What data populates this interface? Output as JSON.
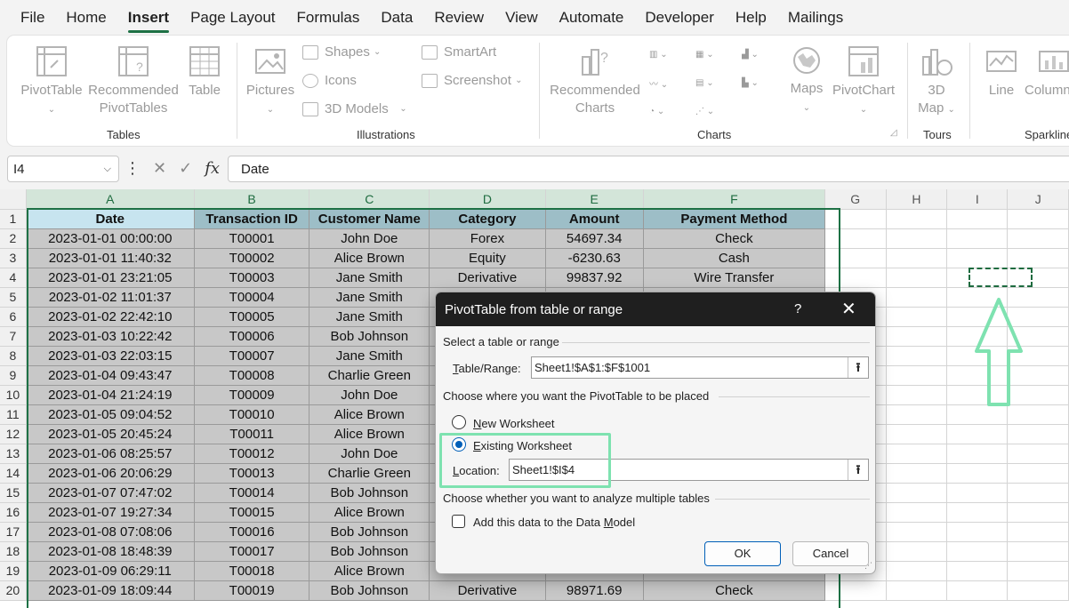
{
  "menu": [
    "File",
    "Home",
    "Insert",
    "Page Layout",
    "Formulas",
    "Data",
    "Review",
    "View",
    "Automate",
    "Developer",
    "Help",
    "Mailings"
  ],
  "active_menu_index": 2,
  "ribbon": {
    "tables": {
      "pivottable": "PivotTable",
      "recommended_pivottables_1": "Recommended",
      "recommended_pivottables_2": "PivotTables",
      "table": "Table",
      "label": "Tables"
    },
    "illustrations": {
      "pictures": "Pictures",
      "shapes": "Shapes",
      "icons": "Icons",
      "models_3d": "3D Models",
      "smartart": "SmartArt",
      "screenshot": "Screenshot",
      "label": "Illustrations"
    },
    "charts": {
      "recommended_1": "Recommended",
      "recommended_2": "Charts",
      "maps": "Maps",
      "pivotchart": "PivotChart",
      "label": "Charts"
    },
    "tours": {
      "map3d_1": "3D",
      "map3d_2": "Map",
      "label": "Tours"
    },
    "sparklines": {
      "line": "Line",
      "column": "Column",
      "label": "Sparklines"
    }
  },
  "formula_bar": {
    "name_box": "I4",
    "fx": "fx",
    "content": "Date"
  },
  "columns": [
    "A",
    "B",
    "C",
    "D",
    "E",
    "F",
    "G",
    "H",
    "I",
    "J"
  ],
  "headers": [
    "Date",
    "Transaction ID",
    "Customer Name",
    "Category",
    "Amount",
    "Payment Method"
  ],
  "rows": [
    [
      "2023-01-01 00:00:00",
      "T00001",
      "John Doe",
      "Forex",
      "54697.34",
      "Check"
    ],
    [
      "2023-01-01 11:40:32",
      "T00002",
      "Alice Brown",
      "Equity",
      "-6230.63",
      "Cash"
    ],
    [
      "2023-01-01 23:21:05",
      "T00003",
      "Jane Smith",
      "Derivative",
      "99837.92",
      "Wire Transfer"
    ],
    [
      "2023-01-02 11:01:37",
      "T00004",
      "Jane Smith",
      "",
      "",
      ""
    ],
    [
      "2023-01-02 22:42:10",
      "T00005",
      "Jane Smith",
      "",
      "",
      ""
    ],
    [
      "2023-01-03 10:22:42",
      "T00006",
      "Bob Johnson",
      "",
      "",
      ""
    ],
    [
      "2023-01-03 22:03:15",
      "T00007",
      "Jane Smith",
      "",
      "",
      ""
    ],
    [
      "2023-01-04 09:43:47",
      "T00008",
      "Charlie Green",
      "",
      "",
      ""
    ],
    [
      "2023-01-04 21:24:19",
      "T00009",
      "John Doe",
      "",
      "",
      ""
    ],
    [
      "2023-01-05 09:04:52",
      "T00010",
      "Alice Brown",
      "",
      "",
      ""
    ],
    [
      "2023-01-05 20:45:24",
      "T00011",
      "Alice Brown",
      "",
      "",
      ""
    ],
    [
      "2023-01-06 08:25:57",
      "T00012",
      "John Doe",
      "",
      "",
      ""
    ],
    [
      "2023-01-06 20:06:29",
      "T00013",
      "Charlie Green",
      "",
      "",
      ""
    ],
    [
      "2023-01-07 07:47:02",
      "T00014",
      "Bob Johnson",
      "",
      "",
      ""
    ],
    [
      "2023-01-07 19:27:34",
      "T00015",
      "Alice Brown",
      "",
      "",
      ""
    ],
    [
      "2023-01-08 07:08:06",
      "T00016",
      "Bob Johnson",
      "",
      "",
      ""
    ],
    [
      "2023-01-08 18:48:39",
      "T00017",
      "Bob Johnson",
      "",
      "",
      ""
    ],
    [
      "2023-01-09 06:29:11",
      "T00018",
      "Alice Brown",
      "",
      "",
      ""
    ],
    [
      "2023-01-09 18:09:44",
      "T00019",
      "Bob Johnson",
      "Derivative",
      "98971.69",
      "Check"
    ]
  ],
  "row_numbers": [
    "1",
    "2",
    "3",
    "4",
    "5",
    "6",
    "7",
    "8",
    "9",
    "10",
    "11",
    "12",
    "13",
    "14",
    "15",
    "16",
    "17",
    "18",
    "19",
    "20"
  ],
  "dialog": {
    "title": "PivotTable from table or range",
    "help": "?",
    "close": "✕",
    "section1": "Select a table or range",
    "range_label_prefix": "T",
    "range_label_rest": "able/Range:",
    "range_value": "Sheet1!$A$1:$F$1001",
    "section2": "Choose where you want the PivotTable to be placed",
    "new_ws_prefix": "N",
    "new_ws_rest": "ew Worksheet",
    "existing_ws_prefix": "E",
    "existing_ws_rest": "xisting Worksheet",
    "location_prefix": "L",
    "location_rest": "ocation:",
    "location_value": "Sheet1!$I$4",
    "section3": "Choose whether you want to analyze multiple tables",
    "datamodel_a": "Add this data to the Data ",
    "datamodel_m": "M",
    "datamodel_b": "odel",
    "ok": "OK",
    "cancel": "Cancel"
  },
  "colors": {
    "accent_green": "#1e7145",
    "highlight_green": "#7ee2b0",
    "dialog_blue": "#005fb8"
  }
}
